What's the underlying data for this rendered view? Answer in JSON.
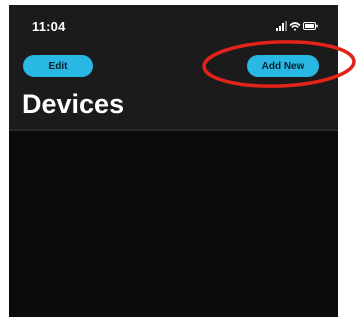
{
  "status_bar": {
    "time": "11:04",
    "icons": [
      "signal-icon",
      "wifi-icon",
      "battery-icon"
    ]
  },
  "nav": {
    "edit_label": "Edit",
    "add_label": "Add New"
  },
  "page": {
    "title": "Devices"
  },
  "colors": {
    "accent": "#29b8e3",
    "background": "#0b0b0b",
    "header": "#1b1b1b",
    "annotation": "#e2231a"
  }
}
